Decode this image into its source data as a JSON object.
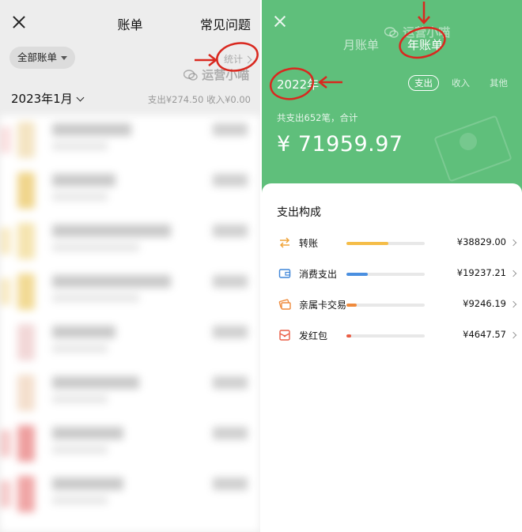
{
  "left": {
    "title": "账单",
    "faq": "常见问题",
    "filter": "全部账单",
    "stats": "统计",
    "month": "2023年1月",
    "summary": "支出¥274.50  收入¥0.00",
    "watermark": "运营小喵"
  },
  "right": {
    "tabs": [
      "月账单",
      "年账单"
    ],
    "active_tab": "年账单",
    "year": "2022年",
    "segments": [
      "支出",
      "收入",
      "其他"
    ],
    "active_segment": "支出",
    "total_label": "共支出652笔，合计",
    "total": "¥ 71959.97",
    "watermark": "运营小喵",
    "section_title": "支出构成",
    "items": [
      {
        "name": "转账",
        "amount": "¥38829.00",
        "share": 0.54,
        "color": "#f5bd48",
        "icon": "transfer-icon"
      },
      {
        "name": "消费支出",
        "amount": "¥19237.21",
        "share": 0.27,
        "color": "#4a8fe0",
        "icon": "wallet-icon"
      },
      {
        "name": "亲属卡交易",
        "amount": "¥9246.19",
        "share": 0.13,
        "color": "#ef8a3c",
        "icon": "family-card-icon"
      },
      {
        "name": "发红包",
        "amount": "¥4647.57",
        "share": 0.06,
        "color": "#ea5d45",
        "icon": "red-packet-icon"
      }
    ]
  },
  "colors": {
    "annotation": "#d9281f",
    "accent_green": "#5fbf7b"
  }
}
